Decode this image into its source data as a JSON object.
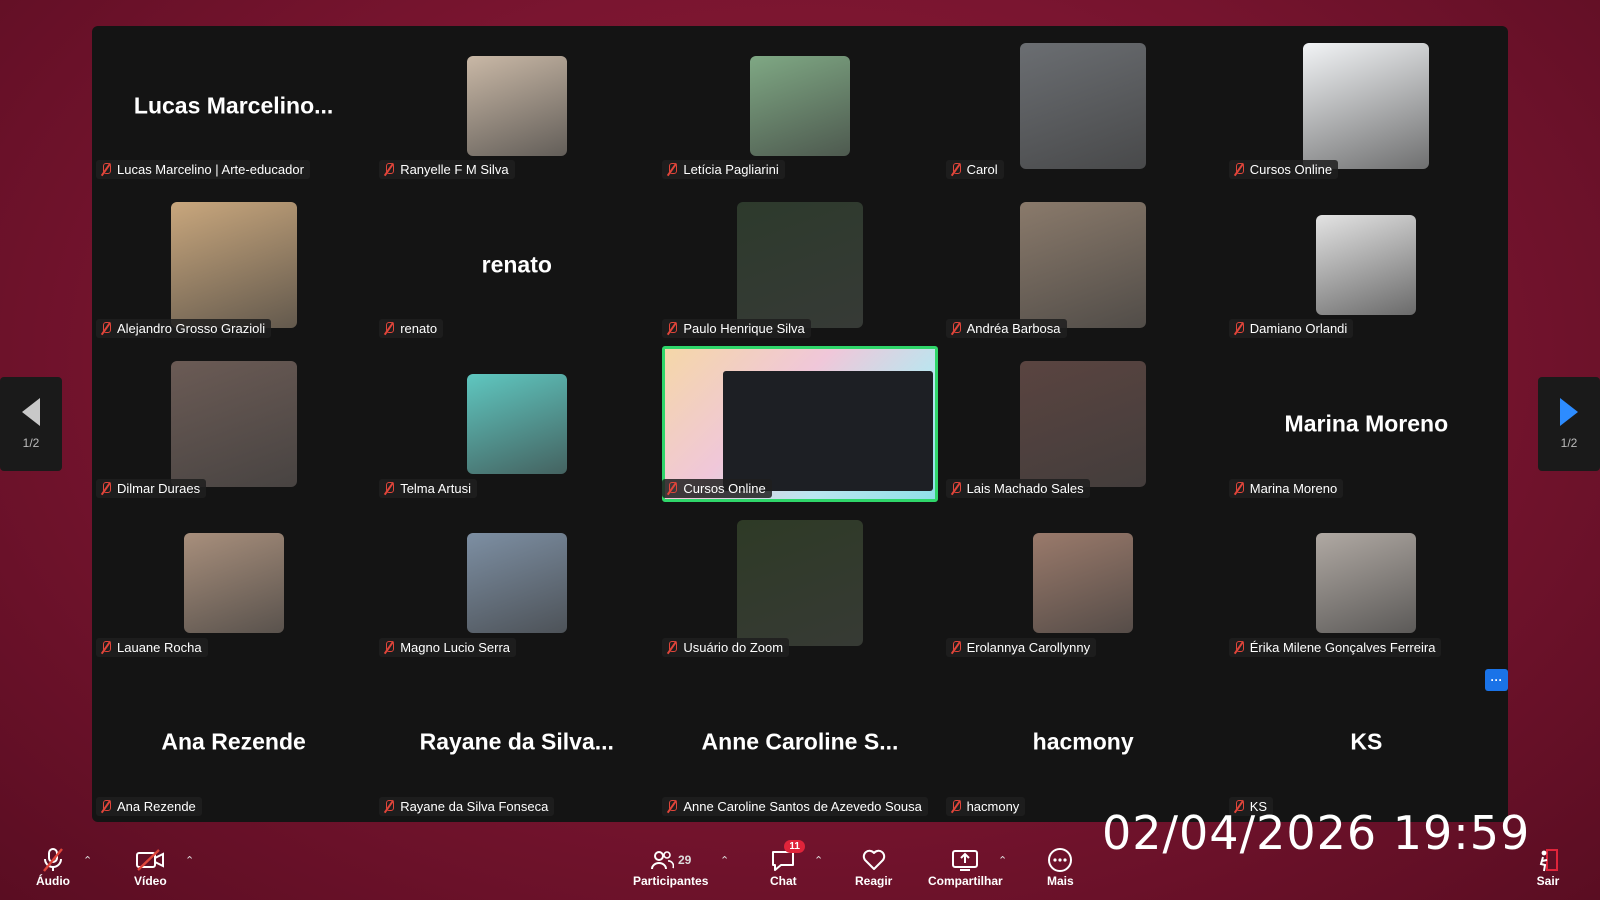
{
  "participants": [
    {
      "name": "Lucas Marcelino | Arte-educador",
      "display_name": "Lucas  Marcelino...",
      "video": false
    },
    {
      "name": "Ranyelle F M Silva",
      "video": true,
      "thumb": "#c9b8a6"
    },
    {
      "name": "Letícia Pagliarini",
      "video": true,
      "thumb": "#7fa884"
    },
    {
      "name": "Carol",
      "video": true,
      "thumb": "#6b6e72"
    },
    {
      "name": "Cursos Online",
      "video": true,
      "thumb": "#f2f4f6"
    },
    {
      "name": "Alejandro Grosso Grazioli",
      "video": true,
      "thumb": "#c9a77d"
    },
    {
      "name": "renato",
      "display_name": "renato",
      "video": false
    },
    {
      "name": "Paulo Henrique Silva",
      "video": true,
      "thumb": "#2d3a2c"
    },
    {
      "name": "Andréa Barbosa",
      "video": true,
      "thumb": "#8a7a6b"
    },
    {
      "name": "Damiano Orlandi",
      "video": true,
      "thumb": "#e3e3e3"
    },
    {
      "name": "Dilmar Duraes",
      "video": true,
      "thumb": "#6b5b55"
    },
    {
      "name": "Telma Artusi",
      "video": true,
      "thumb": "#5fc7c0"
    },
    {
      "name": "Cursos Online",
      "video": true,
      "active": true
    },
    {
      "name": "Lais Machado Sales",
      "video": true,
      "thumb": "#5a4440"
    },
    {
      "name": "Marina Moreno",
      "display_name": "Marina Moreno",
      "video": false
    },
    {
      "name": "Lauane Rocha",
      "video": true,
      "thumb": "#a88f7c"
    },
    {
      "name": "Magno Lucio Serra",
      "video": true,
      "thumb": "#7d8fa3"
    },
    {
      "name": "Usuário do Zoom",
      "video": true,
      "thumb": "#2e3a26"
    },
    {
      "name": "Erolannya Carollynny",
      "video": true,
      "thumb": "#9a7a6b"
    },
    {
      "name": "Érika Milene Gonçalves Ferreira",
      "video": true,
      "thumb": "#b0a9a3"
    },
    {
      "name": "Ana Rezende",
      "display_name": "Ana Rezende",
      "video": false
    },
    {
      "name": "Rayane da Silva Fonseca",
      "display_name": "Rayane da Silva...",
      "video": false
    },
    {
      "name": "Anne Caroline Santos de Azevedo Sousa",
      "display_name": "Anne Caroline S...",
      "video": false
    },
    {
      "name": "hacmony",
      "display_name": "hacmony",
      "video": false
    },
    {
      "name": "KS",
      "display_name": "KS",
      "video": false
    }
  ],
  "pager": {
    "left_page": "1/2",
    "right_page": "1/2"
  },
  "overflow_badge": "···",
  "datetime": "02/04/2026  19:59",
  "toolbar": {
    "audio": "Áudio",
    "video": "Vídeo",
    "participants": "Participantes",
    "participants_count": "29",
    "chat": "Chat",
    "chat_badge": "11",
    "react": "Reagir",
    "share": "Compartilhar",
    "more": "Mais",
    "leave": "Sair"
  },
  "colors": {
    "active_border": "#2fd66a",
    "accent_blue": "#2d8cff",
    "muted_red": "#e0453a",
    "leave_red": "#e0243a"
  }
}
